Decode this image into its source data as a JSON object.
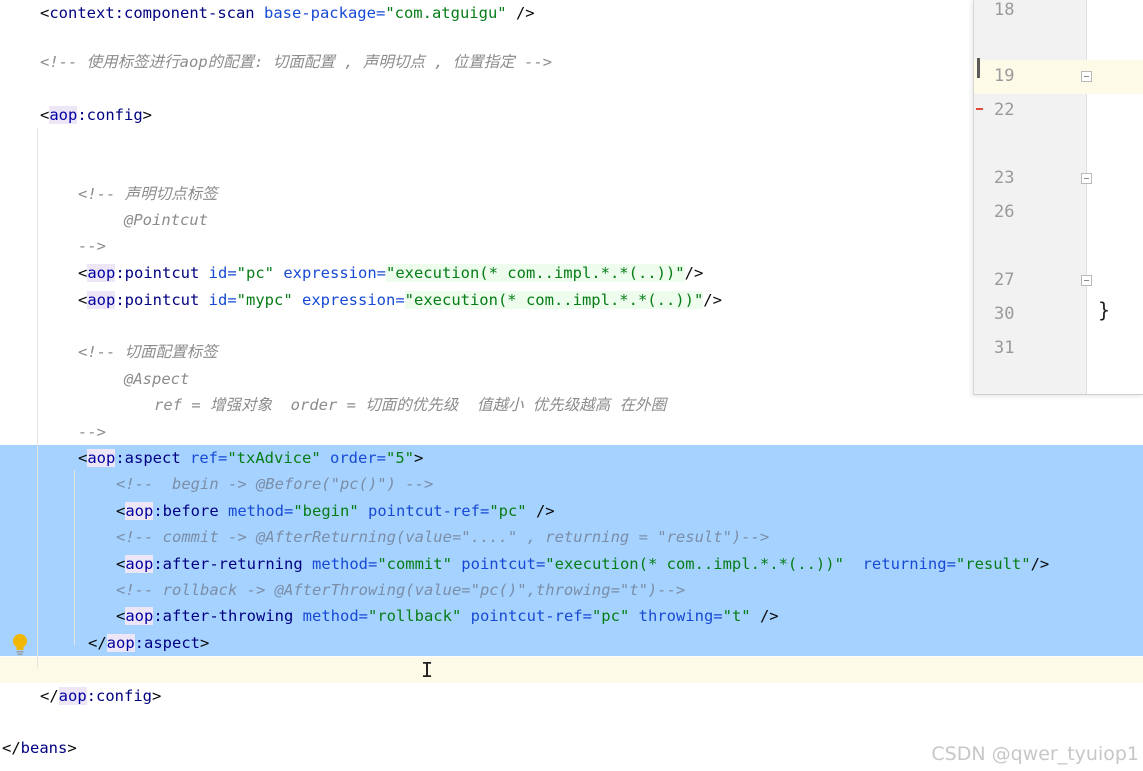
{
  "lines": {
    "l0": {
      "open": "<",
      "tag": "context:component-scan",
      "attr": " base-package=",
      "val": "\"com.atguigu\"",
      "close": " />"
    },
    "l1": {
      "comment": "<!-- 使用标签进行aop的配置: 切面配置 , 声明切点 , 位置指定 -->"
    },
    "l2": {
      "open": "<",
      "ns": "aop",
      "rest": ":config",
      "close": ">"
    },
    "l3": {
      "comment": "<!-- 声明切点标签"
    },
    "l4": {
      "comment": "@Pointcut"
    },
    "l5": {
      "comment": "-->"
    },
    "l6": {
      "ns": "aop",
      "tag": ":pointcut",
      "a1": " id=",
      "v1": "\"pc\"",
      "a2": " expression=",
      "v2": "\"execution(* com..impl.*.*(..))\"",
      "close": "/>"
    },
    "l7": {
      "ns": "aop",
      "tag": ":pointcut",
      "a1": " id=",
      "v1": "\"mypc\"",
      "a2": " expression=",
      "v2": "\"execution(* com..impl.*.*(..))\"",
      "close": "/>"
    },
    "l8": {
      "comment": "<!-- 切面配置标签"
    },
    "l9": {
      "comment": "@Aspect"
    },
    "l10": {
      "comment": "ref = 增强对象  order = 切面的优先级  值越小 优先级越高 在外圈"
    },
    "l11": {
      "comment": "-->"
    },
    "l12": {
      "ns": "aop",
      "tag": ":aspect",
      "a1": " ref=",
      "v1": "\"txAdvice\"",
      "a2": " order=",
      "v2": "\"5\"",
      "close": ">"
    },
    "l13": {
      "comment": "<!--  begin -> @Before(\"pc()\") -->"
    },
    "l14": {
      "ns": "aop",
      "tag": ":before",
      "a1": " method=",
      "v1": "\"begin\"",
      "a2": " pointcut-ref=",
      "v2": "\"pc\"",
      "close": " />"
    },
    "l15": {
      "comment": "<!-- commit -> @AfterReturning(value=\"....\" , returning = \"result\")-->"
    },
    "l16": {
      "ns": "aop",
      "tag": ":after-returning",
      "a1": " method=",
      "v1": "\"commit\"",
      "a2": " pointcut=",
      "v2": "\"execution(* com..impl.*.*(..))\"",
      "a3": "  returning=",
      "v3": "\"result\"",
      "close": "/>"
    },
    "l17": {
      "comment": "<!-- rollback -> @AfterThrowing(value=\"pc()\",throwing=\"t\")-->"
    },
    "l18": {
      "ns": "aop",
      "tag": ":after-throwing",
      "a1": " method=",
      "v1": "\"rollback\"",
      "a2": " pointcut-ref=",
      "v2": "\"pc\"",
      "a3": " throwing=",
      "v3": "\"t\"",
      "close": " />"
    },
    "l19": {
      "open": "</",
      "ns": "aop",
      "rest": ":aspect",
      "close": ">"
    },
    "l20": {
      "open": "</",
      "ns": "aop",
      "rest": ":config",
      "close": ">"
    },
    "l21": {
      "open": "</",
      "rest": "beans",
      "close": ">"
    }
  },
  "side_panel": {
    "line_numbers": [
      "18",
      "19",
      "22",
      "23",
      "26",
      "27",
      "30",
      "31"
    ],
    "brace": "}"
  },
  "watermark": "CSDN @qwer_tyuiop1",
  "colors": {
    "selection": "#a6d2ff",
    "current_line": "#fdfbe8",
    "tag": "#000080",
    "attribute": "#174ad4",
    "value": "#067d17",
    "comment": "#8c8c8c"
  },
  "icons": {
    "intention": "lightbulb-icon",
    "cursor": "text-cursor-icon"
  }
}
